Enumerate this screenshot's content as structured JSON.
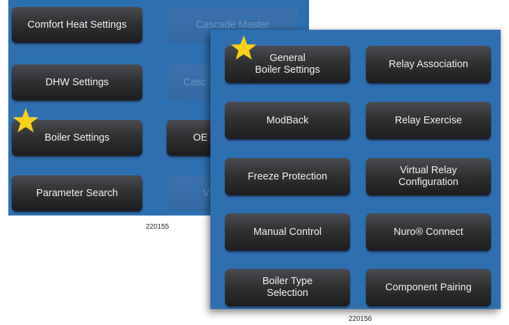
{
  "back_screen": {
    "buttons": {
      "comfort_heat": "Comfort Heat Settings",
      "dhw": "DHW Settings",
      "boiler": "Boiler Settings",
      "parameter_search": "Parameter Search",
      "cascade_master": "Cascade Master",
      "cascade_partial": "Casc",
      "ob_partial": "OE",
      "v_partial": "V"
    },
    "caption": "220155"
  },
  "front_screen": {
    "buttons": {
      "general_boiler": "General\nBoiler Settings",
      "relay_association": "Relay Association",
      "modback": "ModBack",
      "relay_exercise": "Relay Exercise",
      "freeze_protection": "Freeze Protection",
      "virtual_relay": "Virtual Relay\nConfiguration",
      "manual_control": "Manual Control",
      "nuro_connect": "Nuro® Connect",
      "boiler_type": "Boiler Type\nSelection",
      "component_pairing": "Component Pairing"
    },
    "caption": "220156"
  },
  "colors": {
    "panel_blue": "#2e6fb0",
    "button_dark": "#2f3133",
    "star_yellow": "#f7d117"
  },
  "icons": {
    "highlight": "star-icon"
  }
}
